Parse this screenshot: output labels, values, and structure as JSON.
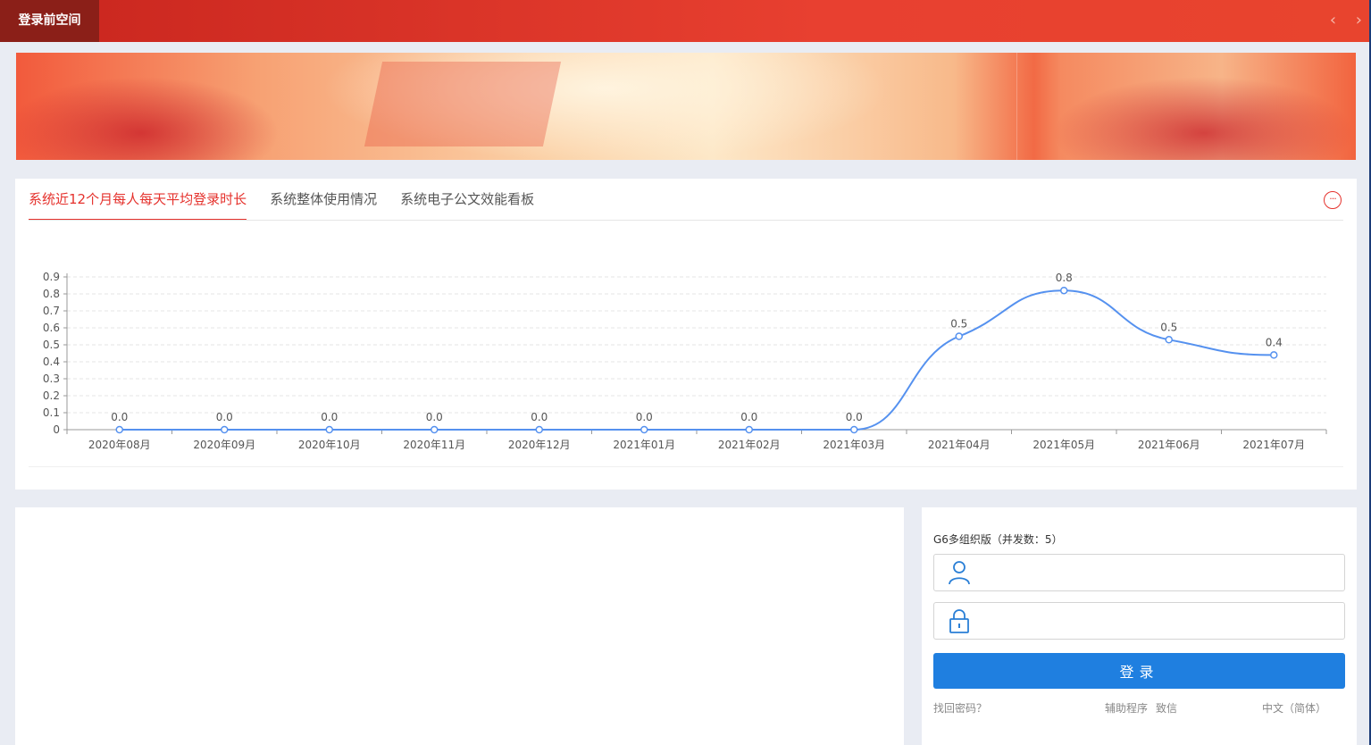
{
  "topbar": {
    "tab_label": "登录前空间",
    "prev_icon": "chevron-left-icon",
    "next_icon": "chevron-right-icon",
    "prev_glyph": "‹",
    "next_glyph": "›"
  },
  "tabs": [
    {
      "label": "系统近12个月每人每天平均登录时长",
      "active": true
    },
    {
      "label": "系统整体使用情况",
      "active": false
    },
    {
      "label": "系统电子公文效能看板",
      "active": false
    }
  ],
  "more_glyph": "···",
  "chart_data": {
    "type": "line",
    "categories": [
      "2020年08月",
      "2020年09月",
      "2020年10月",
      "2020年11月",
      "2020年12月",
      "2021年01月",
      "2021年02月",
      "2021年03月",
      "2021年04月",
      "2021年05月",
      "2021年06月",
      "2021年07月"
    ],
    "values": [
      0.0,
      0.0,
      0.0,
      0.0,
      0.0,
      0.0,
      0.0,
      0.0,
      0.55,
      0.82,
      0.53,
      0.44
    ],
    "data_labels": [
      "0.0",
      "0.0",
      "0.0",
      "0.0",
      "0.0",
      "0.0",
      "0.0",
      "0.0",
      "0.5",
      "0.8",
      "0.5",
      "0.4"
    ],
    "yticks": [
      "0",
      "0.1",
      "0.2",
      "0.3",
      "0.4",
      "0.5",
      "0.6",
      "0.7",
      "0.8",
      "0.9"
    ],
    "ylim": [
      0,
      0.9
    ],
    "grid": true,
    "smooth": true,
    "line_color": "#5591ef"
  },
  "login": {
    "title": "G6多组织版（并发数：5）",
    "username_icon": "user-icon",
    "password_icon": "lock-icon",
    "username_value": "",
    "password_value": "",
    "button_label": "登录",
    "forgot_password": "找回密码？",
    "helper": "辅助程序",
    "thanks": "致信",
    "language": "中文（简体）"
  }
}
